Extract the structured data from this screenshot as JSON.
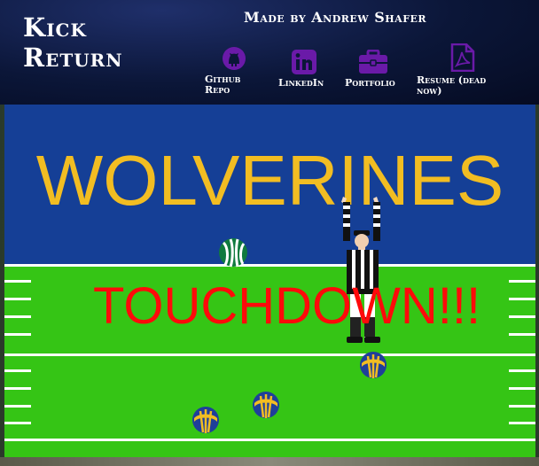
{
  "header": {
    "title_line1": "Kick",
    "title_line2": "Return",
    "credit": "Made by Andrew Shafer",
    "links": [
      {
        "label": "Github Repo",
        "icon": "github-icon"
      },
      {
        "label": "LinkedIn",
        "icon": "linkedin-icon"
      },
      {
        "label": "Portfolio",
        "icon": "briefcase-icon"
      },
      {
        "label": "Resume (dead now)",
        "icon": "pdf-file-icon"
      }
    ],
    "icon_color": "#6a1aa8"
  },
  "game": {
    "endzone_text": "WOLVERINES",
    "message": "TOUCHDOWN!!!",
    "colors": {
      "endzone": "#153f96",
      "endzone_text": "#f2bd22",
      "field": "#35c515",
      "message": "#ff0a0a"
    },
    "sprites": [
      {
        "kind": "opponent-helmet",
        "color": "green-white"
      },
      {
        "kind": "referee",
        "pose": "touchdown-signal"
      },
      {
        "kind": "player-helmet",
        "color": "maize-blue"
      },
      {
        "kind": "player-helmet",
        "color": "maize-blue"
      },
      {
        "kind": "player-helmet",
        "color": "maize-blue"
      }
    ]
  }
}
